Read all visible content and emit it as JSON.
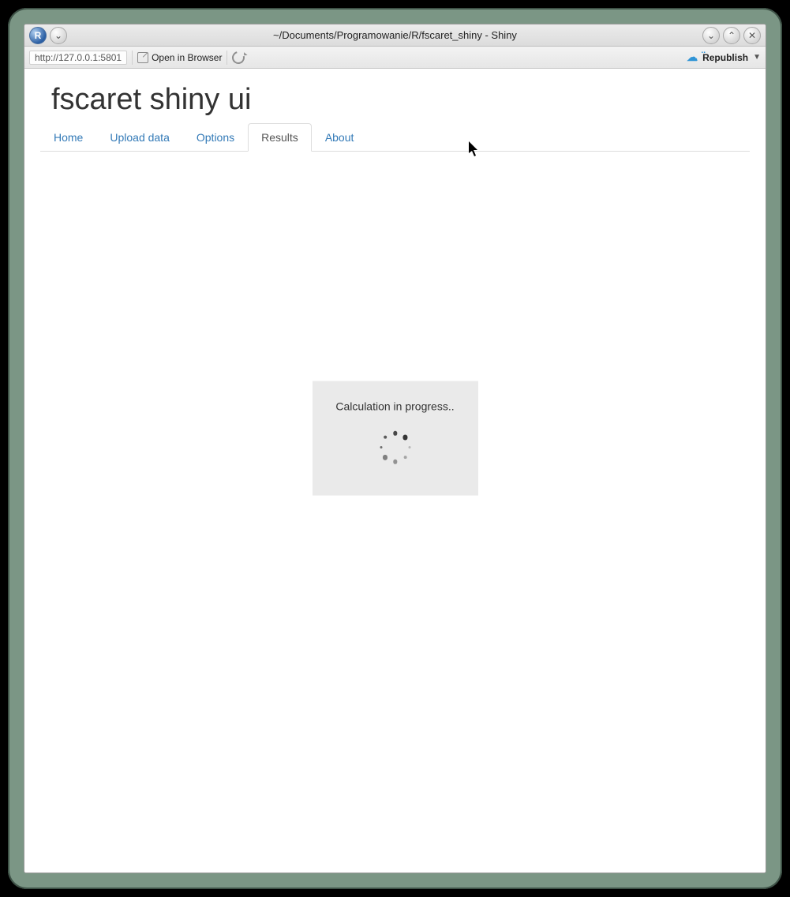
{
  "window": {
    "title": "~/Documents/Programowanie/R/fscaret_shiny - Shiny"
  },
  "toolbar": {
    "url": "http://127.0.0.1:5801",
    "open_in_browser_label": "Open in Browser",
    "republish_label": "Republish"
  },
  "app": {
    "title": "fscaret shiny ui"
  },
  "tabs": [
    {
      "label": "Home",
      "active": false
    },
    {
      "label": "Upload data",
      "active": false
    },
    {
      "label": "Options",
      "active": false
    },
    {
      "label": "Results",
      "active": true
    },
    {
      "label": "About",
      "active": false
    }
  ],
  "status": {
    "message": "Calculation in progress.."
  }
}
